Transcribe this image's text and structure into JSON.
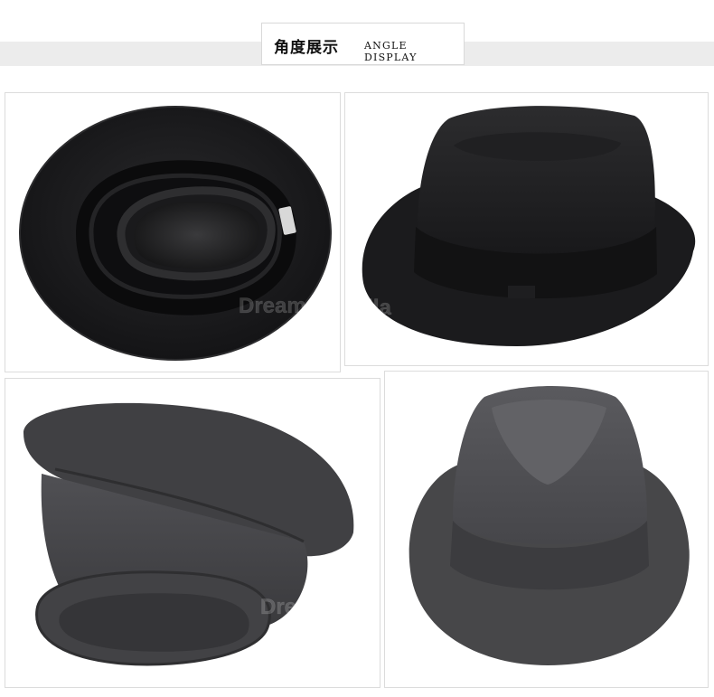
{
  "header": {
    "title_cn": "角度展示",
    "title_en": "ANGLE DISPLAY"
  },
  "watermark": "DreamsinAvila",
  "colors": {
    "band": "#ececec",
    "hat_black": "#1c1c1e",
    "hat_gray": "#4a4a4e"
  },
  "photos": [
    {
      "subject": "black fedora hat, inside view"
    },
    {
      "subject": "black fedora hat, side view"
    },
    {
      "subject": "gray fedora hat, upside-down side view"
    },
    {
      "subject": "gray fedora hat, front view"
    }
  ]
}
